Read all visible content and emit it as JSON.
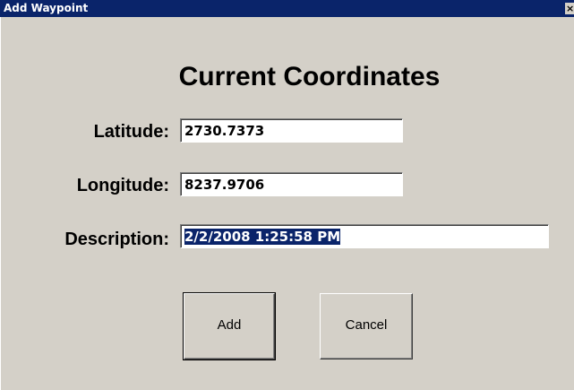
{
  "window": {
    "title": "Add Waypoint",
    "close_glyph": "×"
  },
  "form": {
    "heading": "Current Coordinates",
    "latitude": {
      "label": "Latitude:",
      "value": "2730.7373"
    },
    "longitude": {
      "label": "Longitude:",
      "value": "8237.9706"
    },
    "description": {
      "label": "Description:",
      "value": "2/2/2008 1:25:58 PM",
      "selected": true
    }
  },
  "buttons": {
    "add_label": "Add",
    "cancel_label": "Cancel"
  },
  "colors": {
    "window_face": "#d4d0c8",
    "titlebar": "#0a246a",
    "selection": "#0a246a"
  }
}
